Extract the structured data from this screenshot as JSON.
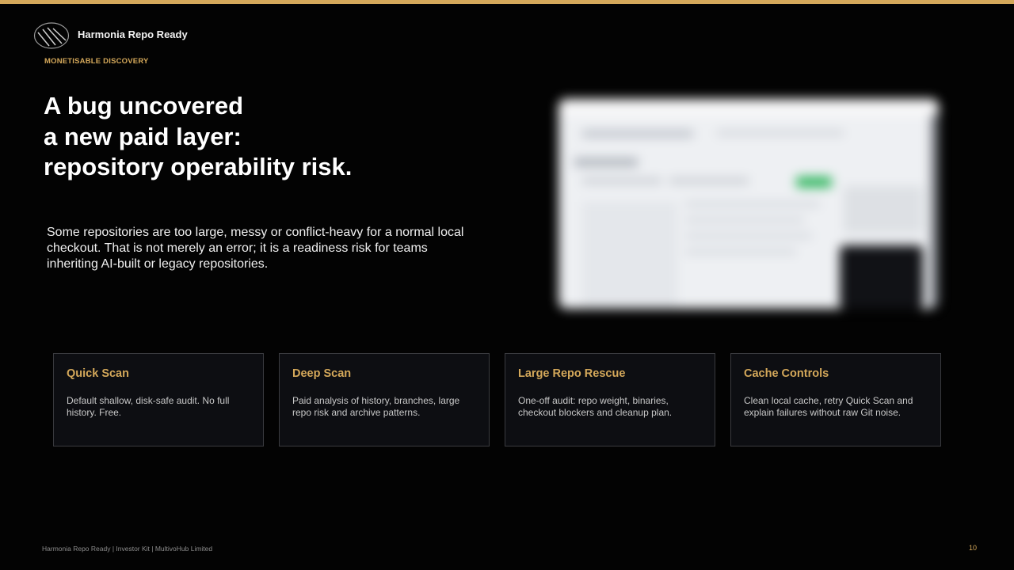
{
  "brand": {
    "name": "Harmonia Repo Ready",
    "accent_color": "#d4a85a",
    "logo_icon": "harmonia-logo-icon"
  },
  "kicker": "MONETISABLE DISCOVERY",
  "headline": {
    "lines": [
      "A bug uncovered",
      "a new paid layer:",
      "repository operability risk."
    ]
  },
  "lede": "Some repositories are too large, messy or conflict-heavy for a normal local checkout. That is not merely an error; it is a readiness risk for teams inheriting AI-built or legacy repositories.",
  "cards": [
    {
      "title": "Quick Scan",
      "description": "Default shallow, disk-safe audit. No full history. Free."
    },
    {
      "title": "Deep Scan",
      "description": "Paid analysis of history, branches, large repo risk and archive patterns."
    },
    {
      "title": "Large Repo Rescue",
      "description": "One-off audit: repo weight, binaries, checkout blockers and cleanup plan."
    },
    {
      "title": "Cache Controls",
      "description": "Clean local cache, retry Quick Scan and explain failures without raw Git noise."
    }
  ],
  "footer": "Harmonia Repo Ready | Investor Kit | MultivoHub Limited",
  "page_number": "10"
}
